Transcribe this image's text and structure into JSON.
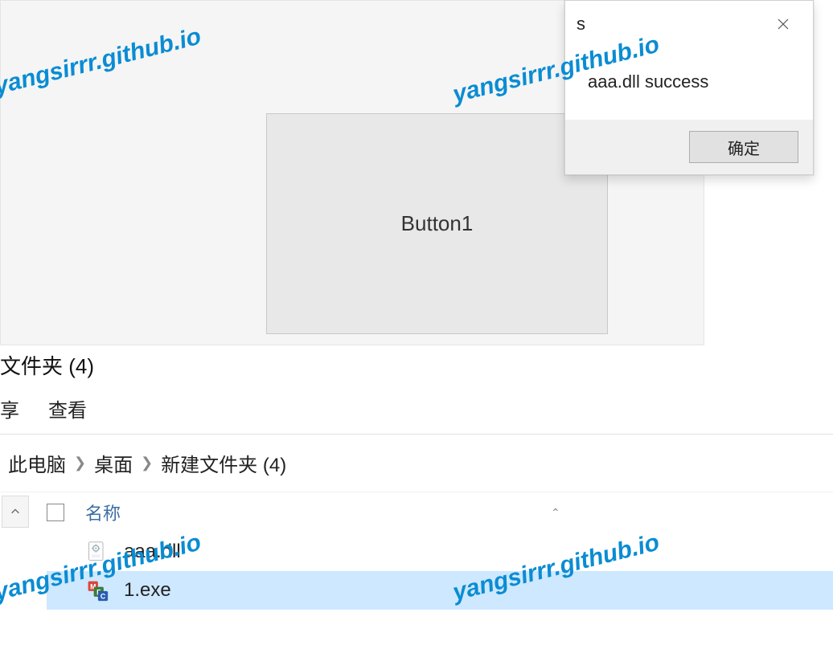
{
  "watermark": "yangsirrr.github.io",
  "app": {
    "button_label": "Button1"
  },
  "msgbox": {
    "title": "s",
    "message": "aaa.dll success",
    "ok_label": "确定"
  },
  "explorer": {
    "title_fragment": "文件夹 (4)",
    "tabs": [
      "享",
      "查看"
    ],
    "breadcrumb": [
      "此电脑",
      "桌面",
      "新建文件夹 (4)"
    ],
    "column_header": "名称",
    "files": [
      {
        "name": "aaa.dll",
        "icon": "dll",
        "selected": false
      },
      {
        "name": "1.exe",
        "icon": "exe",
        "selected": true
      }
    ]
  }
}
